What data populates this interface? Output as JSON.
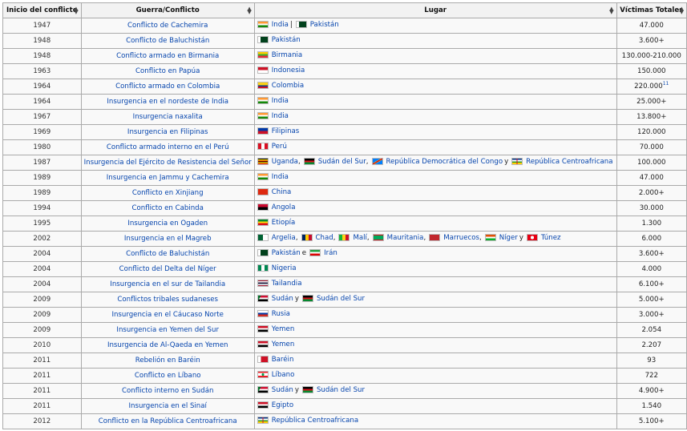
{
  "headers": {
    "year": "Inicio del conflicto",
    "war": "Guerra/Conflicto",
    "place": "Lugar",
    "victims": "Víctimas Totales"
  },
  "rows": [
    {
      "year": "1947",
      "war": "Conflicto de Cachemira",
      "places": [
        {
          "name": "India",
          "flag": "india-flag",
          "sep": "|"
        },
        {
          "name": "Pakistán",
          "flag": "pakistan-flag"
        }
      ],
      "victims": "47.000"
    },
    {
      "year": "1948",
      "war": "Conflicto de Baluchistán",
      "places": [
        {
          "name": "Pakistán",
          "flag": "pakistan-flag"
        }
      ],
      "victims": "3.600+"
    },
    {
      "year": "1948",
      "war": "Conflicto armado en Birmania",
      "places": [
        {
          "name": "Birmania",
          "flag": "myanmar-flag"
        }
      ],
      "victims": "130.000-210.000"
    },
    {
      "year": "1963",
      "war": "Conflicto en Papúa",
      "places": [
        {
          "name": "Indonesia",
          "flag": "indonesia-flag"
        }
      ],
      "victims": "150.000"
    },
    {
      "year": "1964",
      "war": "Conflicto armado en Colombia",
      "places": [
        {
          "name": "Colombia",
          "flag": "colombia-flag"
        }
      ],
      "victims": "220.000",
      "victims_note": "11"
    },
    {
      "year": "1964",
      "war": "Insurgencia en el nordeste de India",
      "places": [
        {
          "name": "India",
          "flag": "india-flag"
        }
      ],
      "victims": "25.000+"
    },
    {
      "year": "1967",
      "war": "Insurgencia naxalita",
      "places": [
        {
          "name": "India",
          "flag": "india-flag"
        }
      ],
      "victims": "13.800+"
    },
    {
      "year": "1969",
      "war": "Insurgencia en Filipinas",
      "places": [
        {
          "name": "Filipinas",
          "flag": "philippines-flag"
        }
      ],
      "victims": "120.000"
    },
    {
      "year": "1980",
      "war": "Conflicto armado interno en el Perú",
      "places": [
        {
          "name": "Perú",
          "flag": "peru-flag"
        }
      ],
      "victims": "70.000"
    },
    {
      "year": "1987",
      "war": "Insurgencia del Ejército de Resistencia del Señor",
      "places": [
        {
          "name": "Uganda",
          "flag": "uganda-flag",
          "sep": ","
        },
        {
          "name": "Sudán del Sur",
          "flag": "south-sudan-flag",
          "sep": ","
        },
        {
          "name": "República Democrática del Congo",
          "flag": "drc-flag",
          "sep": "y"
        },
        {
          "name": "República Centroafricana",
          "flag": "car-flag"
        }
      ],
      "victims": "100.000"
    },
    {
      "year": "1989",
      "war": "Insurgencia en Jammu y Cachemira",
      "places": [
        {
          "name": "India",
          "flag": "india-flag"
        }
      ],
      "victims": "47.000"
    },
    {
      "year": "1989",
      "war": "Conflicto en Xinjiang",
      "places": [
        {
          "name": "China",
          "flag": "china-flag"
        }
      ],
      "victims": "2.000+"
    },
    {
      "year": "1994",
      "war": "Conflicto en Cabinda",
      "places": [
        {
          "name": "Angola",
          "flag": "angola-flag"
        }
      ],
      "victims": "30.000"
    },
    {
      "year": "1995",
      "war": "Insurgencia en Ogaden",
      "places": [
        {
          "name": "Etiopía",
          "flag": "ethiopia-flag"
        }
      ],
      "victims": "1.300"
    },
    {
      "year": "2002",
      "war": "Insurgencia en el Magreb",
      "places": [
        {
          "name": "Argelia",
          "flag": "algeria-flag",
          "sep": ","
        },
        {
          "name": "Chad",
          "flag": "chad-flag",
          "sep": ","
        },
        {
          "name": "Malí",
          "flag": "mali-flag",
          "sep": ","
        },
        {
          "name": "Mauritania",
          "flag": "mauritania-flag",
          "sep": ","
        },
        {
          "name": "Marruecos",
          "flag": "morocco-flag",
          "sep": ","
        },
        {
          "name": "Níger",
          "flag": "niger-flag",
          "sep": "y"
        },
        {
          "name": "Túnez",
          "flag": "tunisia-flag"
        }
      ],
      "victims": "6.000"
    },
    {
      "year": "2004",
      "war": "Conflicto de Baluchistán",
      "places": [
        {
          "name": "Pakistán",
          "flag": "pakistan-flag",
          "sep": "e"
        },
        {
          "name": "Irán",
          "flag": "iran-flag"
        }
      ],
      "victims": "3.600+"
    },
    {
      "year": "2004",
      "war": "Conflicto del Delta del Níger",
      "places": [
        {
          "name": "Nigeria",
          "flag": "nigeria-flag"
        }
      ],
      "victims": "4.000"
    },
    {
      "year": "2004",
      "war": "Insurgencia en el sur de Tailandia",
      "places": [
        {
          "name": "Tailandia",
          "flag": "thailand-flag"
        }
      ],
      "victims": "6.100+"
    },
    {
      "year": "2009",
      "war": "Conflictos tribales sudaneses",
      "places": [
        {
          "name": "Sudán",
          "flag": "sudan-flag",
          "sep": "y"
        },
        {
          "name": "Sudán del Sur",
          "flag": "south-sudan-flag"
        }
      ],
      "victims": "5.000+"
    },
    {
      "year": "2009",
      "war": "Insurgencia en el Cáucaso Norte",
      "places": [
        {
          "name": "Rusia",
          "flag": "russia-flag"
        }
      ],
      "victims": "3.000+"
    },
    {
      "year": "2009",
      "war": "Insurgencia en Yemen del Sur",
      "places": [
        {
          "name": "Yemen",
          "flag": "yemen-flag"
        }
      ],
      "victims": "2.054"
    },
    {
      "year": "2010",
      "war": "Insurgencia de Al-Qaeda en Yemen",
      "places": [
        {
          "name": "Yemen",
          "flag": "yemen-flag"
        }
      ],
      "victims": "2.207"
    },
    {
      "year": "2011",
      "war": "Rebelión en Baréin",
      "places": [
        {
          "name": "Baréin",
          "flag": "bahrain-flag"
        }
      ],
      "victims": "93"
    },
    {
      "year": "2011",
      "war": "Conflicto en Líbano",
      "places": [
        {
          "name": "Líbano",
          "flag": "lebanon-flag"
        }
      ],
      "victims": "722"
    },
    {
      "year": "2011",
      "war": "Conflicto interno en Sudán",
      "places": [
        {
          "name": "Sudán",
          "flag": "sudan-flag",
          "sep": "y"
        },
        {
          "name": "Sudán del Sur",
          "flag": "south-sudan-flag"
        }
      ],
      "victims": "4.900+"
    },
    {
      "year": "2011",
      "war": "Insurgencia en el Sinaí",
      "places": [
        {
          "name": "Egipto",
          "flag": "egypt-flag"
        }
      ],
      "victims": "1.540"
    },
    {
      "year": "2012",
      "war": "Conflicto en la República Centroafricana",
      "places": [
        {
          "name": "República Centroafricana",
          "flag": "car-flag"
        }
      ],
      "victims": "5.100+"
    }
  ],
  "colors": {
    "link": "#0645ad",
    "border": "#aaaaaa",
    "header_bg": "#f2f2f2",
    "cell_bg": "#f9f9f9"
  }
}
